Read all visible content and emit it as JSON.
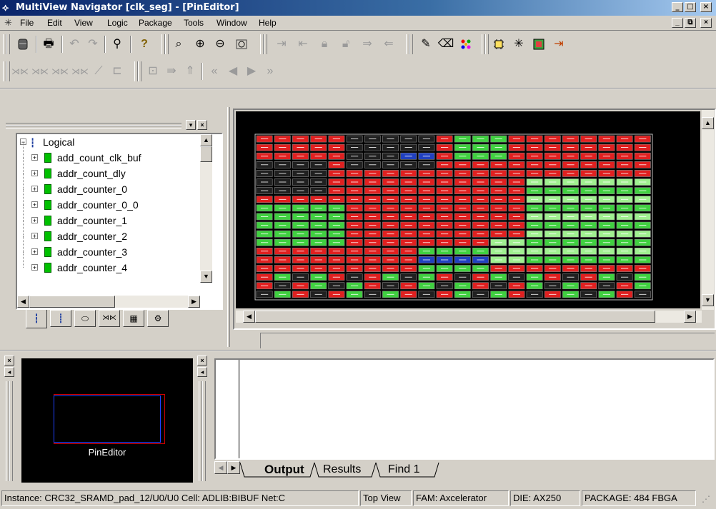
{
  "window": {
    "title": "MultiView Navigator [clk_seg] - [PinEditor]",
    "controls": [
      "_",
      "□",
      "×"
    ]
  },
  "menu": {
    "items": [
      "File",
      "Edit",
      "View",
      "Logic",
      "Package",
      "Tools",
      "Window",
      "Help"
    ],
    "child_controls": [
      "_",
      "⧉",
      "×"
    ]
  },
  "tree": {
    "root": "Logical",
    "items": [
      "add_count_clk_buf",
      "addr_count_dly",
      "addr_counter_0",
      "addr_counter_0_0",
      "addr_counter_1",
      "addr_counter_2",
      "addr_counter_3",
      "addr_counter_4"
    ]
  },
  "preview": {
    "label": "PinEditor"
  },
  "output": {
    "tabs": [
      "Output",
      "Results",
      "Find 1"
    ],
    "active_tab": "Output"
  },
  "status": {
    "instance": "Instance: CRC32_SRAMD_pad_12/U0/U0 Cell: ADLIB:BIBUF Net:C",
    "view": "Top View",
    "family": "FAM: Axcelerator",
    "die": "DIE: AX250",
    "package": "PACKAGE: 484 FBGA"
  },
  "colors": {
    "pin_used": "#e02020",
    "pin_free": "#202020",
    "pin_green": "#40d040",
    "pin_light": "#a0f090",
    "pin_blue": "#2040c0",
    "canvas_bg": "#000000"
  }
}
